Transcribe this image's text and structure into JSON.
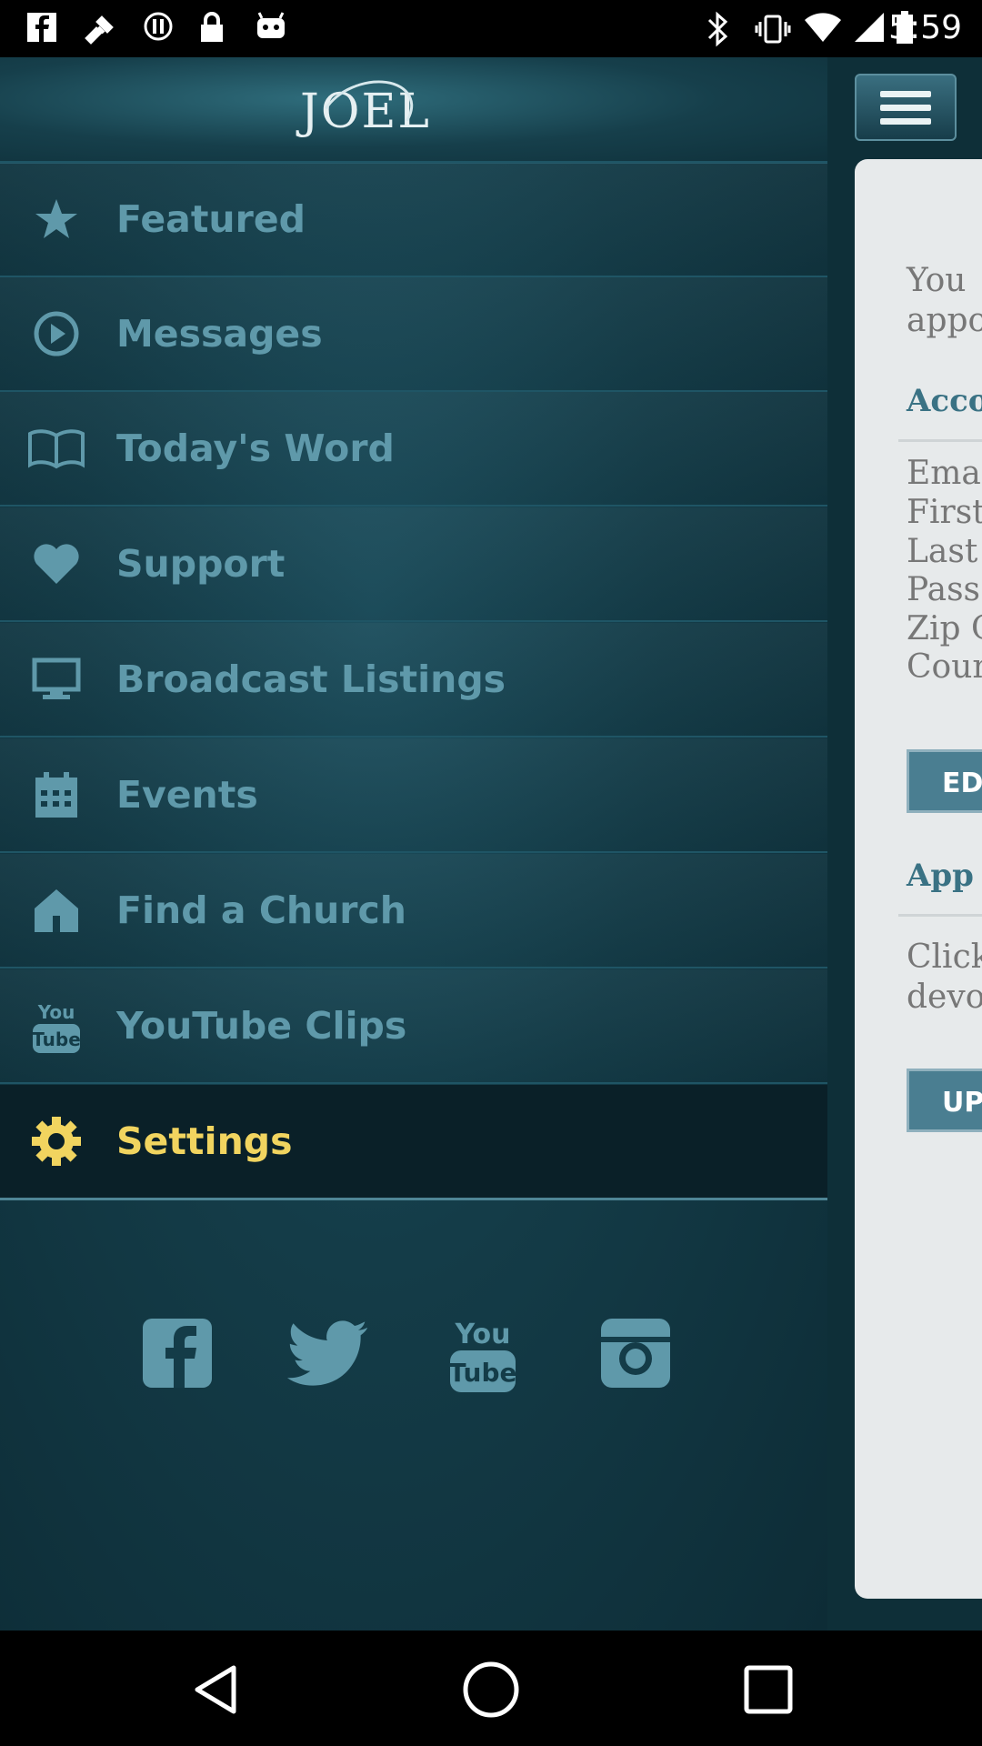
{
  "status_bar": {
    "time": "5:59",
    "left_icons": [
      "facebook-notification-icon",
      "fake-gps-icon",
      "alert-icon",
      "lock-icon",
      "android-icon"
    ],
    "right_icons": [
      "bluetooth-icon",
      "vibrate-icon",
      "wifi-icon",
      "signal-icon",
      "battery-icon"
    ]
  },
  "drawer": {
    "logo_text": "JOEL",
    "items": [
      {
        "label": "Featured",
        "icon": "star-icon",
        "active": false
      },
      {
        "label": "Messages",
        "icon": "play-icon",
        "active": false
      },
      {
        "label": "Today's Word",
        "icon": "book-icon",
        "active": false
      },
      {
        "label": "Support",
        "icon": "heart-icon",
        "active": false
      },
      {
        "label": "Broadcast Listings",
        "icon": "monitor-icon",
        "active": false
      },
      {
        "label": "Events",
        "icon": "calendar-icon",
        "active": false
      },
      {
        "label": "Find a Church",
        "icon": "house-icon",
        "active": false
      },
      {
        "label": "YouTube Clips",
        "icon": "youtube-icon",
        "active": false
      },
      {
        "label": "Settings",
        "icon": "gear-icon",
        "active": true
      }
    ],
    "socials": [
      "facebook-icon",
      "twitter-icon",
      "youtube-icon",
      "instagram-icon"
    ]
  },
  "panel": {
    "intro_line1": "You",
    "intro_line2": "appo",
    "account_heading": "Acco",
    "fields": [
      "Ema",
      "First",
      "Last",
      "Pass",
      "Zip C",
      "Coun"
    ],
    "edit_button": "ED",
    "app_heading": "App",
    "click_line1": "Click",
    "click_line2": "devo",
    "update_button": "UP"
  },
  "colors": {
    "accent": "#5f99aa",
    "active": "#f1d45f",
    "drawer_bg": "#143c48",
    "panel_bg": "#e7eaeb"
  }
}
